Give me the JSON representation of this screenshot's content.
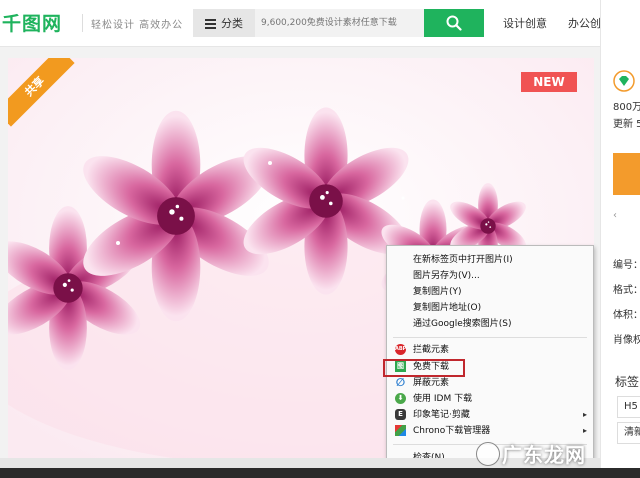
{
  "header": {
    "logo_text": "千图网",
    "slogan": "轻松设计 高效办公",
    "category_label": "分类",
    "search_placeholder": "9,600,200免费设计素材任意下载",
    "nav_items": [
      "设计创意",
      "办公创意"
    ],
    "brand_color": "#1fb35d"
  },
  "image_card": {
    "share_ribbon": "共享",
    "new_badge": "NEW"
  },
  "right_panel": {
    "stat_text_1": "800万",
    "stat_text_2": "更新 5",
    "info_labels": [
      "编号：",
      "格式：",
      "体积：",
      "肖像权"
    ],
    "tag_title": "标签",
    "tag_chip_1": "H5",
    "tag_chip_2": "清新"
  },
  "context_menu": {
    "group1": [
      "在新标签页中打开图片(I)",
      "图片另存为(V)...",
      "复制图片(Y)",
      "复制图片地址(O)",
      "通过Google搜索图片(S)"
    ],
    "group2": [
      {
        "label": "拦截元素",
        "icon": "abp-icon",
        "arrow": false
      },
      {
        "label": "免费下载",
        "icon": "image-download-icon",
        "arrow": false
      },
      {
        "label": "屏蔽元素",
        "icon": "block-icon",
        "arrow": false
      },
      {
        "label": "使用 IDM 下载",
        "icon": "idm-icon",
        "arrow": false
      },
      {
        "label": "印象笔记·剪藏",
        "icon": "evernote-icon",
        "arrow": true
      },
      {
        "label": "Chrono下载管理器",
        "icon": "chrono-icon",
        "arrow": true
      }
    ],
    "inspect": "检查(N)"
  },
  "watermark": {
    "text": "广东龙网"
  }
}
